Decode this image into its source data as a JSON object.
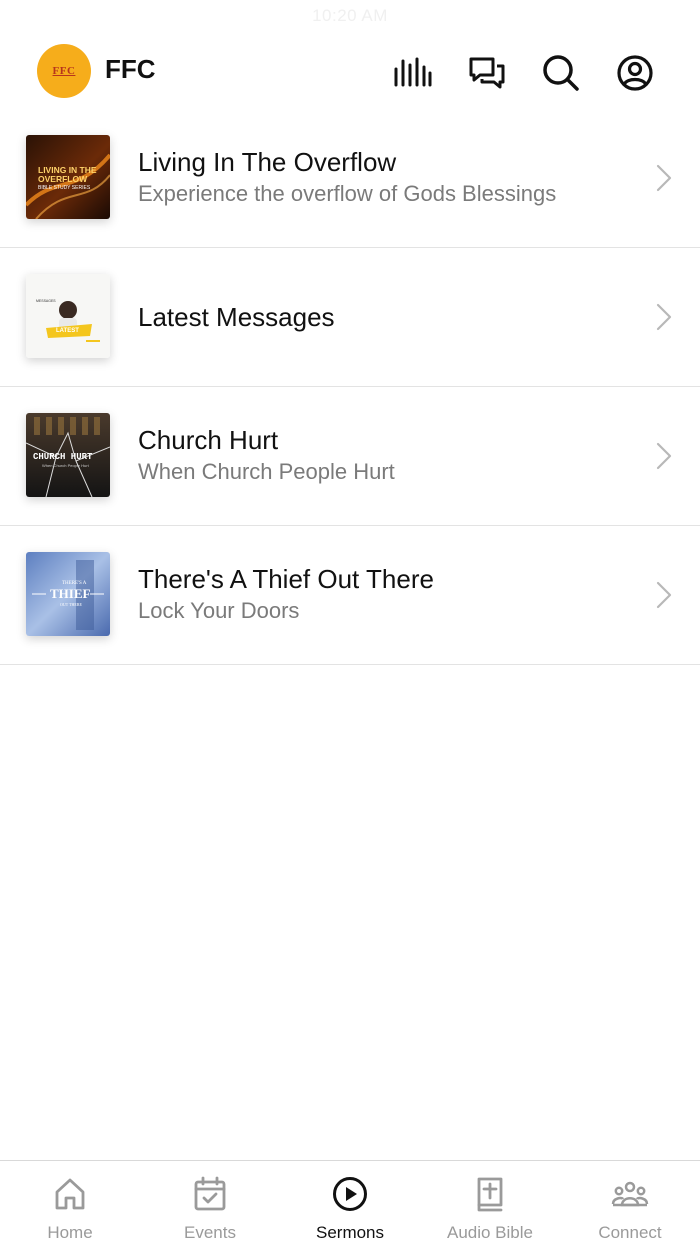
{
  "status": {
    "time": "10:20 AM"
  },
  "header": {
    "logo_text": "FFC",
    "title": "FFC",
    "icons": [
      "bars-icon",
      "chat-icon",
      "search-icon",
      "profile-icon"
    ]
  },
  "sermons": [
    {
      "title": "Living In The Overflow",
      "subtitle": "Experience the overflow of Gods Blessings",
      "thumb_text": "LIVING IN THE OVERFLOW",
      "thumb_caption": "BIBLE STUDY SERIES"
    },
    {
      "title": "Latest Messages",
      "subtitle": "",
      "thumb_text": "LATEST",
      "thumb_caption": "Message"
    },
    {
      "title": "Church Hurt",
      "subtitle": "When Church People Hurt",
      "thumb_text": "CHURCH HURT",
      "thumb_caption": "When Church People Hurt"
    },
    {
      "title": "There's A Thief Out There",
      "subtitle": "Lock Your Doors",
      "thumb_text": "THIEF",
      "thumb_caption": "THERE'S A"
    }
  ],
  "tabs": [
    {
      "label": "Home",
      "icon": "home-icon",
      "active": false
    },
    {
      "label": "Events",
      "icon": "calendar-icon",
      "active": false
    },
    {
      "label": "Sermons",
      "icon": "play-circle-icon",
      "active": true
    },
    {
      "label": "Audio Bible",
      "icon": "bible-icon",
      "active": false
    },
    {
      "label": "Connect",
      "icon": "people-icon",
      "active": false
    }
  ],
  "colors": {
    "accent": "#f6ad1b",
    "active": "#111111",
    "inactive": "#9a9a9a"
  }
}
